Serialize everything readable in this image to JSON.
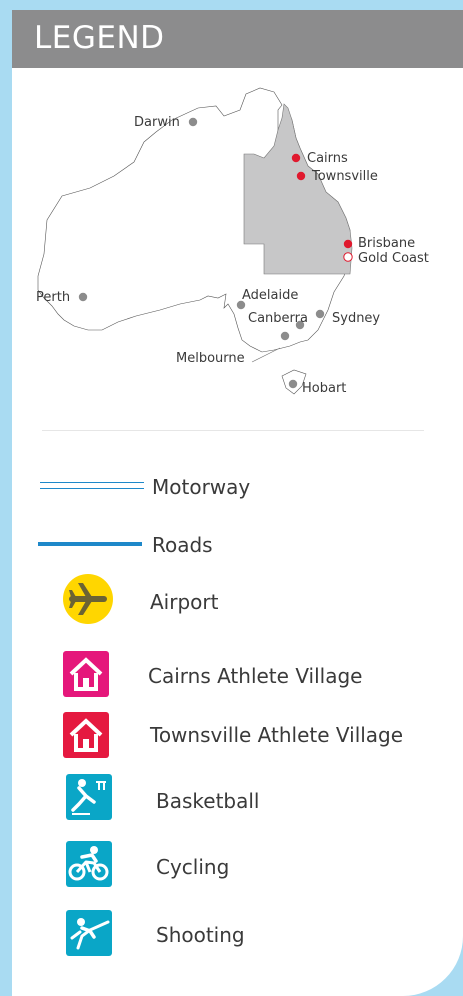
{
  "header": {
    "title": "LEGEND"
  },
  "map": {
    "cities": [
      {
        "name": "Darwin",
        "color": "#8c8c8c"
      },
      {
        "name": "Cairns",
        "color": "#e0192e"
      },
      {
        "name": "Townsville",
        "color": "#e0192e"
      },
      {
        "name": "Brisbane",
        "color": "#e0192e"
      },
      {
        "name": "Gold Coast",
        "color": "#ffffff"
      },
      {
        "name": "Perth",
        "color": "#8c8c8c"
      },
      {
        "name": "Adelaide",
        "color": "#8c8c8c"
      },
      {
        "name": "Canberra",
        "color": "#8c8c8c"
      },
      {
        "name": "Sydney",
        "color": "#8c8c8c"
      },
      {
        "name": "Melbourne",
        "color": "#8c8c8c"
      },
      {
        "name": "Hobart",
        "color": "#8c8c8c"
      }
    ],
    "highlight_state_color": "#c7c7c8"
  },
  "legend": {
    "motorway": "Motorway",
    "roads": "Roads",
    "airport": "Airport",
    "cairns_village": "Cairns Athlete Village",
    "townsville_village": "Townsville Athlete Village",
    "basketball": "Basketball",
    "cycling": "Cycling",
    "shooting": "Shooting"
  },
  "colors": {
    "background": "#a9dbf2",
    "header": "#8c8c8d",
    "motorway": "#1e88c9",
    "road": "#1e88c9",
    "airport": "#ffd600",
    "cairns_village": "#e5177b",
    "townsville_village": "#e51940",
    "sport": "#0aa6c7"
  },
  "icons": [
    "airplane-icon",
    "house-icon",
    "basketball-icon",
    "cycling-icon",
    "shooting-icon"
  ]
}
